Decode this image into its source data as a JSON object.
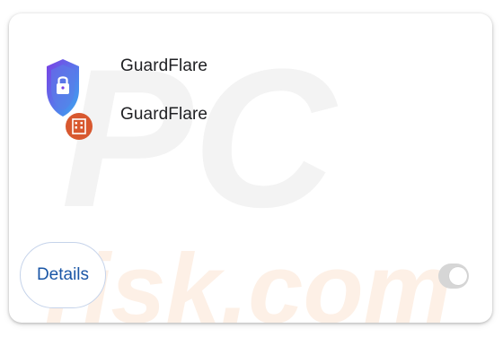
{
  "extension": {
    "icon": "shield-lock-icon",
    "badge_icon": "building-badge-icon",
    "name": "GuardFlare",
    "description": "GuardFlare",
    "enabled": false
  },
  "actions": {
    "details_label": "Details"
  },
  "watermark": {
    "top_text": "PC",
    "bottom_text": "risk.com"
  },
  "colors": {
    "details_text": "#1a56a6",
    "details_border": "#c5d3ea",
    "toggle_track": "#d6d6d6",
    "badge": "#d8582f",
    "shield_gradient": [
      "#7b3fe4",
      "#3aa8f0"
    ]
  }
}
